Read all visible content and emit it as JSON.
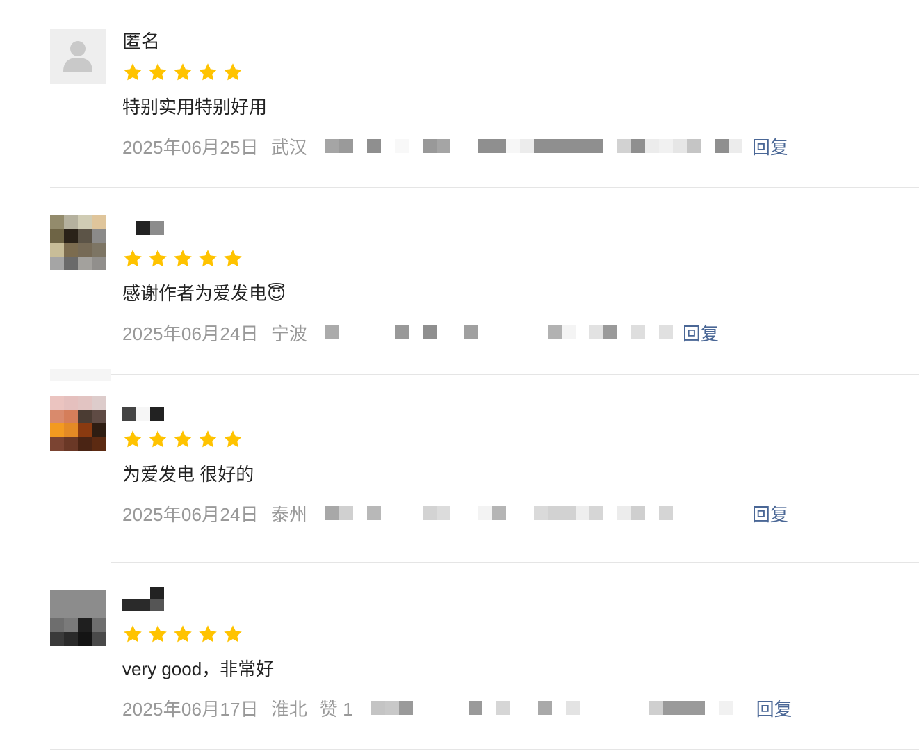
{
  "comments": [
    {
      "name": "匿名",
      "rating": 5,
      "content": "特别实用特别好用",
      "date": "2025年06月25日",
      "location": "武汉",
      "likes": "",
      "reply": "回复"
    },
    {
      "name": "",
      "rating": 5,
      "content": "感谢作者为爱发电😇",
      "date": "2025年06月24日",
      "location": "宁波",
      "likes": "",
      "reply": "回复"
    },
    {
      "name": "",
      "rating": 5,
      "content": "为爱发电 很好的",
      "date": "2025年06月24日",
      "location": "泰州",
      "likes": "",
      "reply": "回复"
    },
    {
      "name": "",
      "rating": 5,
      "content": "very good，非常好",
      "date": "2025年06月17日",
      "location": "淮北",
      "likes": "赞 1",
      "reply": "回复"
    }
  ],
  "colors": {
    "star": "#FFC300",
    "reply_link": "#4a6796",
    "meta_text": "#999999",
    "divider": "#e5e5e5"
  },
  "icons": {
    "default_avatar": "user-silhouette-icon",
    "rating": "star-icon"
  }
}
